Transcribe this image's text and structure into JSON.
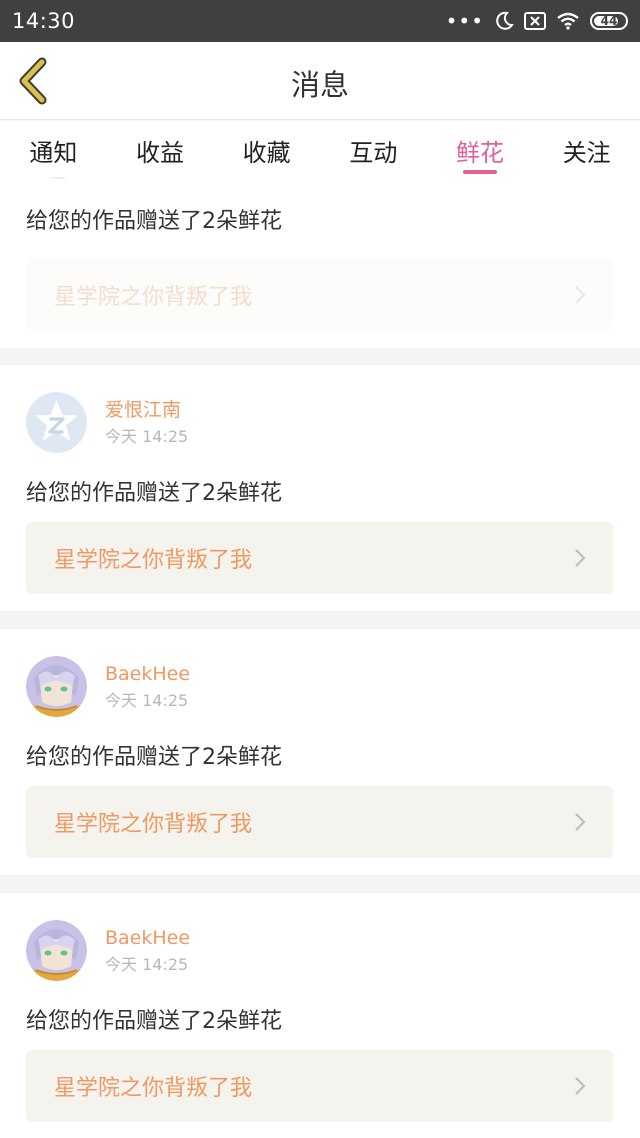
{
  "status_bar": {
    "time": "14:30",
    "battery": "44",
    "dots": "•••"
  },
  "header": {
    "title": "消息"
  },
  "tabs": [
    {
      "label": "通知"
    },
    {
      "label": "收益"
    },
    {
      "label": "收藏"
    },
    {
      "label": "互动"
    },
    {
      "label": "鲜花",
      "active": true
    },
    {
      "label": "关注"
    }
  ],
  "items": [
    {
      "message": "给您的作品赠送了2朵鲜花",
      "work_title": "星学院之你背叛了我"
    },
    {
      "username": "爱恨江南",
      "time": "今天 14:25",
      "message": "给您的作品赠送了2朵鲜花",
      "work_title": "星学院之你背叛了我"
    },
    {
      "username": "BaekHee",
      "time": "今天 14:25",
      "message": "给您的作品赠送了2朵鲜花",
      "work_title": "星学院之你背叛了我"
    },
    {
      "username": "BaekHee",
      "time": "今天 14:25",
      "message": "给您的作品赠送了2朵鲜花",
      "work_title": "星学院之你背叛了我"
    }
  ],
  "colors": {
    "accent_pink": "#e0609a",
    "orange": "#ef9a63",
    "back_arrow": "#d9c24a"
  }
}
